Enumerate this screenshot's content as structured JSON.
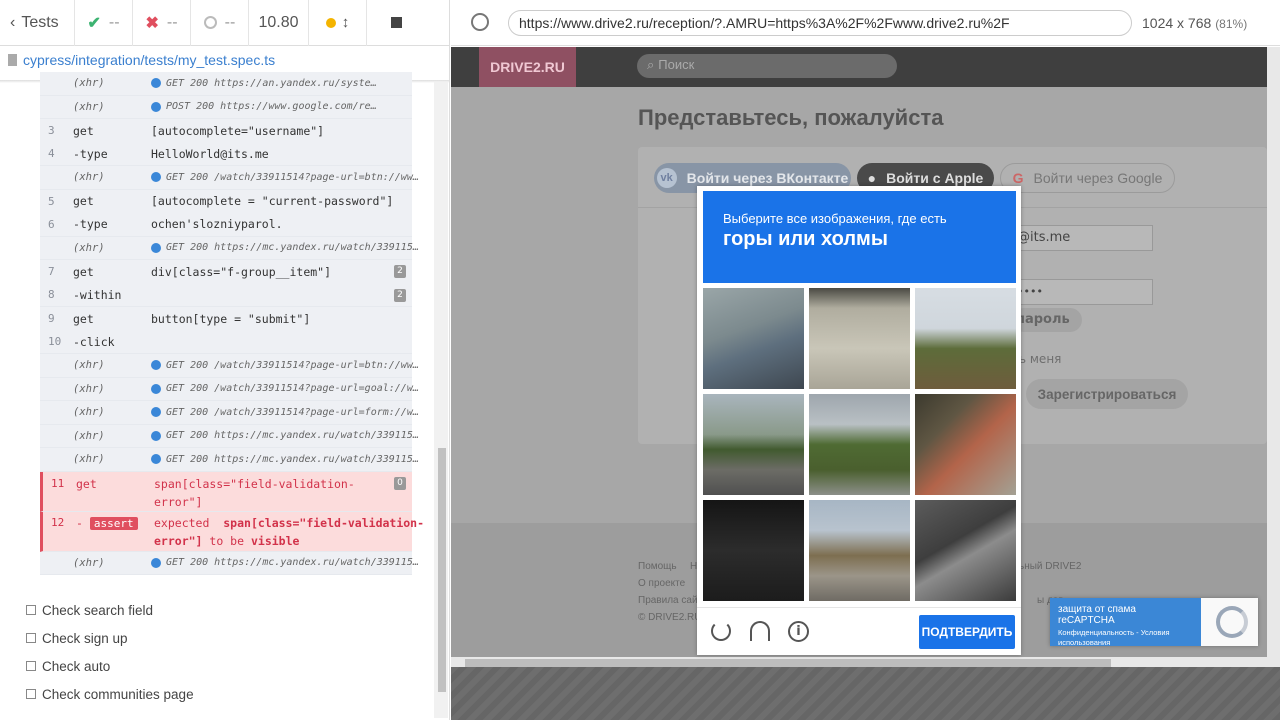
{
  "runner": {
    "tests_label": "Tests",
    "passed": "--",
    "failed": "--",
    "pending": "--",
    "duration": "10.80",
    "spec_path": "cypress/integration/tests/my_test.spec.ts"
  },
  "url_bar": {
    "url": "https://www.drive2.ru/reception/?.AMRU=https%3A%2F%2Fwww.drive2.ru%2F",
    "viewport_size": "1024 x 768",
    "zoom": "(81%)"
  },
  "commands": [
    {
      "num": "",
      "cmd": "(xhr)",
      "msg": "GET 200 https://an.yandex.ru/syste…",
      "type": "xhr"
    },
    {
      "num": "",
      "cmd": "(xhr)",
      "msg": "POST 200 https://www.google.com/re…",
      "type": "xhr"
    },
    {
      "num": "3",
      "cmd": "get",
      "msg": "[autocomplete=\"username\"]",
      "type": "cmd"
    },
    {
      "num": "4",
      "cmd": "-type",
      "msg": "HelloWorld@its.me",
      "type": "cmd"
    },
    {
      "num": "",
      "cmd": "(xhr)",
      "msg": "GET 200 /watch/33911514?page-url=btn://ww…",
      "type": "xhr"
    },
    {
      "num": "5",
      "cmd": "get",
      "msg": "[autocomplete = \"current-password\"]",
      "type": "cmd"
    },
    {
      "num": "6",
      "cmd": "-type",
      "msg": "ochen'slozniyparol.",
      "type": "cmd"
    },
    {
      "num": "",
      "cmd": "(xhr)",
      "msg": "GET 200 https://mc.yandex.ru/watch/339115…",
      "type": "xhr"
    },
    {
      "num": "7",
      "cmd": "get",
      "msg": "div[class=\"f-group__item\"]",
      "type": "cmd",
      "badge": "2"
    },
    {
      "num": "8",
      "cmd": "-within",
      "msg": "",
      "type": "cmd",
      "badge": "2"
    },
    {
      "num": "9",
      "cmd": "get",
      "msg": "button[type = \"submit\"]",
      "type": "cmd"
    },
    {
      "num": "10",
      "cmd": "-click",
      "msg": "",
      "type": "cmd"
    },
    {
      "num": "",
      "cmd": "(xhr)",
      "msg": "GET 200 /watch/33911514?page-url=btn://ww…",
      "type": "xhr"
    },
    {
      "num": "",
      "cmd": "(xhr)",
      "msg": "GET 200 /watch/33911514?page-url=goal://w…",
      "type": "xhr"
    },
    {
      "num": "",
      "cmd": "(xhr)",
      "msg": "GET 200 /watch/33911514?page-url=form://w…",
      "type": "xhr"
    },
    {
      "num": "",
      "cmd": "(xhr)",
      "msg": "GET 200 https://mc.yandex.ru/watch/339115…",
      "type": "xhr"
    },
    {
      "num": "",
      "cmd": "(xhr)",
      "msg": "GET 200 https://mc.yandex.ru/watch/339115…",
      "type": "xhr"
    }
  ],
  "error_get": {
    "num": "11",
    "cmd": "get",
    "msg1": "span[class=\"field-validation-",
    "msg2": "error\"]",
    "badge": "0"
  },
  "error_assert": {
    "num": "12",
    "cmd": "assert",
    "msg1a": "expected",
    "msg1b": "span[class=\"field-validation-",
    "msg2a": "error\"]",
    "msg2b": "to be",
    "msg2c": "visible"
  },
  "last_xhr": {
    "cmd": "(xhr)",
    "msg": "GET 200 https://mc.yandex.ru/watch/339115…"
  },
  "tests": [
    "Check search field",
    "Check sign up",
    "Check auto",
    "Check communities page"
  ],
  "site": {
    "logo": "DRIVE2.RU",
    "search_placeholder": "Поиск",
    "title": "Представьтесь, пожалуйста",
    "vk_button": "Войти через ВКонтакте",
    "apple_button": "Войти с Apple",
    "google_button": "Войти через Google",
    "email_partial": "@its.me",
    "password_partial": "••••",
    "forgot_partial": "пароль",
    "remember_partial": "ть меня",
    "register_button": "Зарегистрироваться",
    "footer_links": [
      "Помощь",
      "Н",
      "О проекте",
      "Правила сай",
      "© DRIVE2.RU"
    ],
    "footer_right": "ьный DRIVE2",
    "footer_right2": "ы дав"
  },
  "captcha": {
    "instruction": "Выберите все изображения, где есть",
    "target": "горы или холмы",
    "verify": "ПОДТВЕРДИТЬ"
  },
  "recaptcha_badge": {
    "line1": "защита от спама reCAPTCHA",
    "line2": "Конфиденциальность - Условия использования"
  },
  "colors": {
    "accent": "#1a73e8",
    "error": "#e04f5f",
    "link": "#3a7fcf"
  }
}
